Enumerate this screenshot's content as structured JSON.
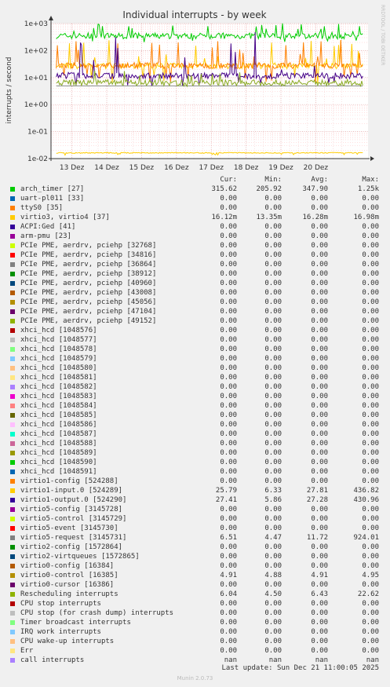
{
  "chart_data": {
    "type": "line",
    "title": "Individual interrupts - by week",
    "ylabel": "interrupts / second",
    "side_label": "RRDTOOL / TOBI OETIKER",
    "yscale": "log",
    "ylim": [
      0.01,
      1000
    ],
    "yticks": [
      "1e+03",
      "1e+02",
      "1e+01",
      "1e+00",
      "1e-01",
      "1e-02"
    ],
    "ytick_values": [
      1000,
      100,
      10,
      1,
      0.1,
      0.01
    ],
    "xticks": [
      "13 Dez",
      "14 Dez",
      "15 Dez",
      "16 Dez",
      "17 Dez",
      "18 Dez",
      "19 Dez",
      "20 Dez"
    ],
    "xlim_days": [
      12.4,
      21.5
    ],
    "grid": true,
    "series": [
      {
        "name": "arch_timer [27]",
        "color": "#00cc00",
        "avg": 347.9,
        "min": 205.92,
        "max": 1250
      },
      {
        "name": "virtio3, virtio4 [37]",
        "color": "#ffcc00",
        "avg": 0.01628,
        "min": 0.01335,
        "max": 0.01698
      },
      {
        "name": "virtio1-output.0 [524290]",
        "color": "#ffcc00",
        "avg": 27.28,
        "min": 5.86,
        "max": 430.96
      },
      {
        "name": "virtio1-input.0 [524289]",
        "color": "#ff8000",
        "avg": 27.81,
        "min": 6.33,
        "max": 436.82
      },
      {
        "name": "virtio5-request [3145731]",
        "color": "#440088",
        "avg": 11.72,
        "min": 4.47,
        "max": 924.01
      },
      {
        "name": "virtio0-control [16385]",
        "color": "#888888",
        "avg": 4.91,
        "min": 4.88,
        "max": 4.95
      },
      {
        "name": "Rescheduling interrupts",
        "color": "#88aa22",
        "avg": 6.43,
        "min": 4.5,
        "max": 22.62
      }
    ]
  },
  "legend": {
    "headers": [
      "Cur:",
      "Min:",
      "Avg:",
      "Max:"
    ],
    "rows": [
      {
        "color": "#00cc00",
        "name": "arch_timer [27]",
        "cur": "315.62",
        "min": "205.92",
        "avg": "347.90",
        "max": "1.25k"
      },
      {
        "color": "#0066b3",
        "name": "uart-pl011 [33]",
        "cur": "0.00",
        "min": "0.00",
        "avg": "0.00",
        "max": "0.00"
      },
      {
        "color": "#ff8000",
        "name": "ttyS0 [35]",
        "cur": "0.00",
        "min": "0.00",
        "avg": "0.00",
        "max": "0.00"
      },
      {
        "color": "#ffcc00",
        "name": "virtio3, virtio4 [37]",
        "cur": "16.12m",
        "min": "13.35m",
        "avg": "16.28m",
        "max": "16.98m"
      },
      {
        "color": "#330099",
        "name": "ACPI:Ged [41]",
        "cur": "0.00",
        "min": "0.00",
        "avg": "0.00",
        "max": "0.00"
      },
      {
        "color": "#990099",
        "name": "arm-pmu [23]",
        "cur": "0.00",
        "min": "0.00",
        "avg": "0.00",
        "max": "0.00"
      },
      {
        "color": "#ccff00",
        "name": "PCIe PME, aerdrv, pciehp [32768]",
        "cur": "0.00",
        "min": "0.00",
        "avg": "0.00",
        "max": "0.00"
      },
      {
        "color": "#ff0000",
        "name": "PCIe PME, aerdrv, pciehp [34816]",
        "cur": "0.00",
        "min": "0.00",
        "avg": "0.00",
        "max": "0.00"
      },
      {
        "color": "#808080",
        "name": "PCIe PME, aerdrv, pciehp [36864]",
        "cur": "0.00",
        "min": "0.00",
        "avg": "0.00",
        "max": "0.00"
      },
      {
        "color": "#008f00",
        "name": "PCIe PME, aerdrv, pciehp [38912]",
        "cur": "0.00",
        "min": "0.00",
        "avg": "0.00",
        "max": "0.00"
      },
      {
        "color": "#00487d",
        "name": "PCIe PME, aerdrv, pciehp [40960]",
        "cur": "0.00",
        "min": "0.00",
        "avg": "0.00",
        "max": "0.00"
      },
      {
        "color": "#b35a00",
        "name": "PCIe PME, aerdrv, pciehp [43008]",
        "cur": "0.00",
        "min": "0.00",
        "avg": "0.00",
        "max": "0.00"
      },
      {
        "color": "#b38f00",
        "name": "PCIe PME, aerdrv, pciehp [45056]",
        "cur": "0.00",
        "min": "0.00",
        "avg": "0.00",
        "max": "0.00"
      },
      {
        "color": "#6b006b",
        "name": "PCIe PME, aerdrv, pciehp [47104]",
        "cur": "0.00",
        "min": "0.00",
        "avg": "0.00",
        "max": "0.00"
      },
      {
        "color": "#8fb300",
        "name": "PCIe PME, aerdrv, pciehp [49152]",
        "cur": "0.00",
        "min": "0.00",
        "avg": "0.00",
        "max": "0.00"
      },
      {
        "color": "#b30000",
        "name": "xhci_hcd [1048576]",
        "cur": "0.00",
        "min": "0.00",
        "avg": "0.00",
        "max": "0.00"
      },
      {
        "color": "#bebebe",
        "name": "xhci_hcd [1048577]",
        "cur": "0.00",
        "min": "0.00",
        "avg": "0.00",
        "max": "0.00"
      },
      {
        "color": "#80ff80",
        "name": "xhci_hcd [1048578]",
        "cur": "0.00",
        "min": "0.00",
        "avg": "0.00",
        "max": "0.00"
      },
      {
        "color": "#80c9ff",
        "name": "xhci_hcd [1048579]",
        "cur": "0.00",
        "min": "0.00",
        "avg": "0.00",
        "max": "0.00"
      },
      {
        "color": "#ffc080",
        "name": "xhci_hcd [1048580]",
        "cur": "0.00",
        "min": "0.00",
        "avg": "0.00",
        "max": "0.00"
      },
      {
        "color": "#ffe680",
        "name": "xhci_hcd [1048581]",
        "cur": "0.00",
        "min": "0.00",
        "avg": "0.00",
        "max": "0.00"
      },
      {
        "color": "#aa80ff",
        "name": "xhci_hcd [1048582]",
        "cur": "0.00",
        "min": "0.00",
        "avg": "0.00",
        "max": "0.00"
      },
      {
        "color": "#ee00cc",
        "name": "xhci_hcd [1048583]",
        "cur": "0.00",
        "min": "0.00",
        "avg": "0.00",
        "max": "0.00"
      },
      {
        "color": "#ff8080",
        "name": "xhci_hcd [1048584]",
        "cur": "0.00",
        "min": "0.00",
        "avg": "0.00",
        "max": "0.00"
      },
      {
        "color": "#666600",
        "name": "xhci_hcd [1048585]",
        "cur": "0.00",
        "min": "0.00",
        "avg": "0.00",
        "max": "0.00"
      },
      {
        "color": "#ffbfff",
        "name": "xhci_hcd [1048586]",
        "cur": "0.00",
        "min": "0.00",
        "avg": "0.00",
        "max": "0.00"
      },
      {
        "color": "#00ffcc",
        "name": "xhci_hcd [1048587]",
        "cur": "0.00",
        "min": "0.00",
        "avg": "0.00",
        "max": "0.00"
      },
      {
        "color": "#cc6699",
        "name": "xhci_hcd [1048588]",
        "cur": "0.00",
        "min": "0.00",
        "avg": "0.00",
        "max": "0.00"
      },
      {
        "color": "#999900",
        "name": "xhci_hcd [1048589]",
        "cur": "0.00",
        "min": "0.00",
        "avg": "0.00",
        "max": "0.00"
      },
      {
        "color": "#00cc00",
        "name": "xhci_hcd [1048590]",
        "cur": "0.00",
        "min": "0.00",
        "avg": "0.00",
        "max": "0.00"
      },
      {
        "color": "#0066b3",
        "name": "xhci_hcd [1048591]",
        "cur": "0.00",
        "min": "0.00",
        "avg": "0.00",
        "max": "0.00"
      },
      {
        "color": "#ff8000",
        "name": "virtio1-config [524288]",
        "cur": "0.00",
        "min": "0.00",
        "avg": "0.00",
        "max": "0.00"
      },
      {
        "color": "#ffcc00",
        "name": "virtio1-input.0 [524289]",
        "cur": "25.79",
        "min": "6.33",
        "avg": "27.81",
        "max": "436.82"
      },
      {
        "color": "#330099",
        "name": "virtio1-output.0 [524290]",
        "cur": "27.41",
        "min": "5.86",
        "avg": "27.28",
        "max": "430.96"
      },
      {
        "color": "#990099",
        "name": "virtio5-config [3145728]",
        "cur": "0.00",
        "min": "0.00",
        "avg": "0.00",
        "max": "0.00"
      },
      {
        "color": "#ccff00",
        "name": "virtio5-control [3145729]",
        "cur": "0.00",
        "min": "0.00",
        "avg": "0.00",
        "max": "0.00"
      },
      {
        "color": "#ff0000",
        "name": "virtio5-event [3145730]",
        "cur": "0.00",
        "min": "0.00",
        "avg": "0.00",
        "max": "0.00"
      },
      {
        "color": "#808080",
        "name": "virtio5-request [3145731]",
        "cur": "6.51",
        "min": "4.47",
        "avg": "11.72",
        "max": "924.01"
      },
      {
        "color": "#008f00",
        "name": "virtio2-config [1572864]",
        "cur": "0.00",
        "min": "0.00",
        "avg": "0.00",
        "max": "0.00"
      },
      {
        "color": "#00487d",
        "name": "virtio2-virtqueues [1572865]",
        "cur": "0.00",
        "min": "0.00",
        "avg": "0.00",
        "max": "0.00"
      },
      {
        "color": "#b35a00",
        "name": "virtio0-config [16384]",
        "cur": "0.00",
        "min": "0.00",
        "avg": "0.00",
        "max": "0.00"
      },
      {
        "color": "#b38f00",
        "name": "virtio0-control [16385]",
        "cur": "4.91",
        "min": "4.88",
        "avg": "4.91",
        "max": "4.95"
      },
      {
        "color": "#6b006b",
        "name": "virtio0-cursor [16386]",
        "cur": "0.00",
        "min": "0.00",
        "avg": "0.00",
        "max": "0.00"
      },
      {
        "color": "#8fb300",
        "name": "Rescheduling interrupts",
        "cur": "6.04",
        "min": "4.50",
        "avg": "6.43",
        "max": "22.62"
      },
      {
        "color": "#b30000",
        "name": "CPU stop interrupts",
        "cur": "0.00",
        "min": "0.00",
        "avg": "0.00",
        "max": "0.00"
      },
      {
        "color": "#bebebe",
        "name": "CPU stop (for crash dump) interrupts",
        "cur": "0.00",
        "min": "0.00",
        "avg": "0.00",
        "max": "0.00"
      },
      {
        "color": "#80ff80",
        "name": "Timer broadcast interrupts",
        "cur": "0.00",
        "min": "0.00",
        "avg": "0.00",
        "max": "0.00"
      },
      {
        "color": "#80c9ff",
        "name": "IRQ work interrupts",
        "cur": "0.00",
        "min": "0.00",
        "avg": "0.00",
        "max": "0.00"
      },
      {
        "color": "#ffc080",
        "name": "CPU wake-up interrupts",
        "cur": "0.00",
        "min": "0.00",
        "avg": "0.00",
        "max": "0.00"
      },
      {
        "color": "#ffe680",
        "name": "Err",
        "cur": "0.00",
        "min": "0.00",
        "avg": "0.00",
        "max": "0.00"
      },
      {
        "color": "#aa80ff",
        "name": "call interrupts",
        "cur": "nan",
        "min": "nan",
        "avg": "nan",
        "max": "nan"
      }
    ]
  },
  "footer": {
    "last_update": "Last update: Sun Dec 21 11:00:05 2025",
    "version": "Munin 2.0.73"
  }
}
